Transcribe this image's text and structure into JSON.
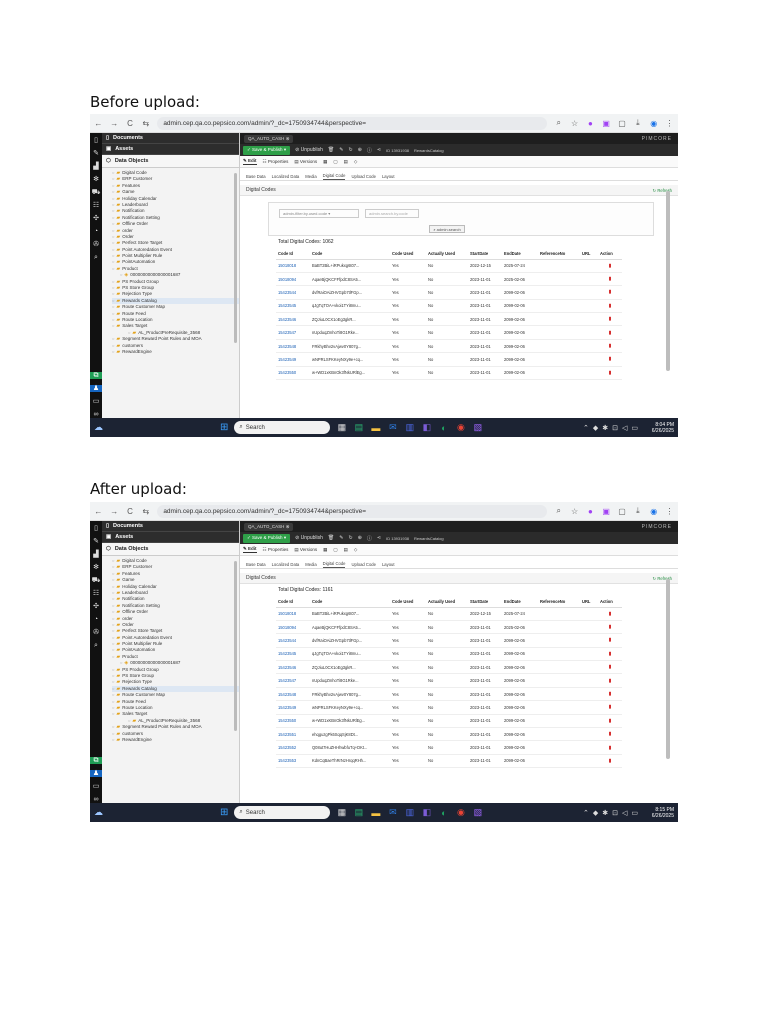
{
  "sections": {
    "before_title": "Before upload:",
    "after_title": "After upload:"
  },
  "browser": {
    "url": "admin.cep.qa.co.pepsico.com/admin/?_dc=1750934744&perspective="
  },
  "app": {
    "tab_label": "QA_AUTO_CASH",
    "logo": "PIMCORE",
    "toolbar": {
      "save_publish": "Save & Publish",
      "unpublish": "Unpublish",
      "id_text": "ID 13931938",
      "class_text": "RewardsCatalog"
    },
    "subtabs": [
      "Edit",
      "Properties",
      "Versions"
    ],
    "category_tabs": [
      "Base Data",
      "Localized Data",
      "Media",
      "Digital Code",
      "Upload Code",
      "Layout"
    ],
    "panel_title": "Digital Codes",
    "refresh_label": "Refresh",
    "filter": {
      "select_placeholder": "admin-filter.by.used.code",
      "search_placeholder": "admin.search.by.code",
      "search_button": "admin.search"
    }
  },
  "sidebar": {
    "documents": "Documents",
    "assets": "Assets",
    "data_objects": "Data Objects",
    "items": [
      {
        "label": "Digital Code",
        "level": 0
      },
      {
        "label": "ERP Customer",
        "level": 0
      },
      {
        "label": "Features",
        "level": 0
      },
      {
        "label": "Game",
        "level": 0
      },
      {
        "label": "Holiday Calendar",
        "level": 0
      },
      {
        "label": "Leaderboard",
        "level": 0
      },
      {
        "label": "Notification",
        "level": 0
      },
      {
        "label": "Notification Setting",
        "level": 0
      },
      {
        "label": "Offline Order",
        "level": 0
      },
      {
        "label": "order",
        "level": 0
      },
      {
        "label": "Order",
        "level": 0
      },
      {
        "label": "Perfect Store Target",
        "level": 0
      },
      {
        "label": "Point Autoredation Event",
        "level": 0
      },
      {
        "label": "Point Multiplier Rule",
        "level": 0
      },
      {
        "label": "PointAutomation",
        "level": 0
      },
      {
        "label": "Product",
        "level": 0
      },
      {
        "label": "00000000000000001687",
        "level": 1
      },
      {
        "label": "PS Product Group",
        "level": 0
      },
      {
        "label": "PS Store Group",
        "level": 0
      },
      {
        "label": "Rejection Type",
        "level": 0
      },
      {
        "label": "Rewards Catalog",
        "level": 0
      },
      {
        "label": "Route Customer Map",
        "level": 0
      },
      {
        "label": "Route Feed",
        "level": 0
      },
      {
        "label": "Route Location",
        "level": 0
      },
      {
        "label": "Sales Target",
        "level": 0
      },
      {
        "label": "AL_ProductPreRequisite_3568",
        "level": 2
      },
      {
        "label": "Segment Reward Point Rules and MOA",
        "level": 0
      },
      {
        "label": "customers",
        "level": 0
      },
      {
        "label": "RewardEngine",
        "level": 0
      }
    ]
  },
  "before": {
    "total": "Total Digital Codes: 1062",
    "columns": [
      "Code Id",
      "Code",
      "Code Used",
      "Actually Used",
      "StartDate",
      "EndDate",
      "ReferenceNo",
      "URL",
      "Action"
    ],
    "rows": [
      [
        "15018018",
        "BaBT2BiL+iRPukxg6t07...",
        "Yes",
        "No",
        "2022-12-15",
        "2025-07-24"
      ],
      [
        "15018094",
        "AqaeBjQKCFFfpdC8SA5...",
        "Yes",
        "No",
        "2023-11-01",
        "2025-02-06"
      ],
      [
        "15423544",
        "dvfRaiOAiZHVGpb7tlFGp...",
        "Yes",
        "No",
        "2023-11-01",
        "2099-02-06"
      ],
      [
        "15423545",
        "qJgTqTOA+vkoi1TYi8mu...",
        "Yes",
        "No",
        "2023-11-01",
        "2099-02-06"
      ],
      [
        "15423546",
        "ZQJiuL0CX1oEg3gkR...",
        "Yes",
        "No",
        "2023-11-01",
        "2099-02-06"
      ],
      [
        "15423547",
        "nUpduqZmhoTi8G1Rke...",
        "Yes",
        "No",
        "2023-11-01",
        "2099-02-06"
      ],
      [
        "15423548",
        "FRkhyBhv2vAjwv0Y807g...",
        "Yes",
        "No",
        "2023-11-01",
        "2099-02-06"
      ],
      [
        "15423549",
        "wNPRLSFKKeyNXy9e+cq...",
        "Yes",
        "No",
        "2023-11-01",
        "2099-02-06"
      ],
      [
        "15423550",
        "w+WD1xKBnOk3fNkURlEg...",
        "Yes",
        "No",
        "2023-11-01",
        "2099-02-06"
      ]
    ],
    "clock": {
      "time": "8:04 PM",
      "date": "6/26/2025"
    }
  },
  "after": {
    "total": "Total Digital Codes: 1161",
    "columns": [
      "Code Id",
      "Code",
      "Code Used",
      "Actually Used",
      "StartDate",
      "EndDate",
      "ReferenceNo",
      "URL",
      "Action"
    ],
    "rows": [
      [
        "15018018",
        "BaBT2BiL+iRPukxg6t07...",
        "Yes",
        "No",
        "2022-12-15",
        "2025-07-24"
      ],
      [
        "15018094",
        "AqaeBjQKCFFfpdC8SA5...",
        "Yes",
        "No",
        "2023-11-01",
        "2025-02-06"
      ],
      [
        "15423544",
        "dvfRaiOAiZHVGpb7tlFGp...",
        "Yes",
        "No",
        "2023-11-01",
        "2099-02-06"
      ],
      [
        "15423545",
        "qJgTqTOA+vkoi1TYi8mu...",
        "Yes",
        "No",
        "2023-11-01",
        "2099-02-06"
      ],
      [
        "15423546",
        "ZQJiuL0CX1oEg3gkR...",
        "Yes",
        "No",
        "2023-11-01",
        "2099-02-06"
      ],
      [
        "15423547",
        "nUpduqZmhoTi8G1Rke...",
        "Yes",
        "No",
        "2023-11-01",
        "2099-02-06"
      ],
      [
        "15423548",
        "FRkhyBhv2vAjwv0Y807g...",
        "Yes",
        "No",
        "2023-11-01",
        "2099-02-06"
      ],
      [
        "15423549",
        "wNPRLSFKKeyNXy9e+cq...",
        "Yes",
        "No",
        "2023-11-01",
        "2099-02-06"
      ],
      [
        "15423550",
        "w+WD1xKBnOk3fNkURlEg...",
        "Yes",
        "No",
        "2023-11-01",
        "2099-02-06"
      ],
      [
        "15423551",
        "ehqguzgPk6SqqSjK8Dt...",
        "Yes",
        "No",
        "2023-11-01",
        "2099-02-06"
      ],
      [
        "15423552",
        "Q08ut7HuZHHhwbfuTq+DKt...",
        "Yes",
        "No",
        "2023-11-01",
        "2099-02-06"
      ],
      [
        "15423553",
        "KdnCqBaeThRrNzHrqqRHh...",
        "Yes",
        "No",
        "2023-11-01",
        "2099-02-06"
      ]
    ],
    "clock": {
      "time": "8:15 PM",
      "date": "6/26/2025"
    }
  },
  "taskbar": {
    "search_label": "Search"
  },
  "colors": {
    "save_green": "#2e9f48",
    "link_blue": "#1a5fb4",
    "delete_red": "#d32020",
    "taskbar": "#1c2333"
  }
}
